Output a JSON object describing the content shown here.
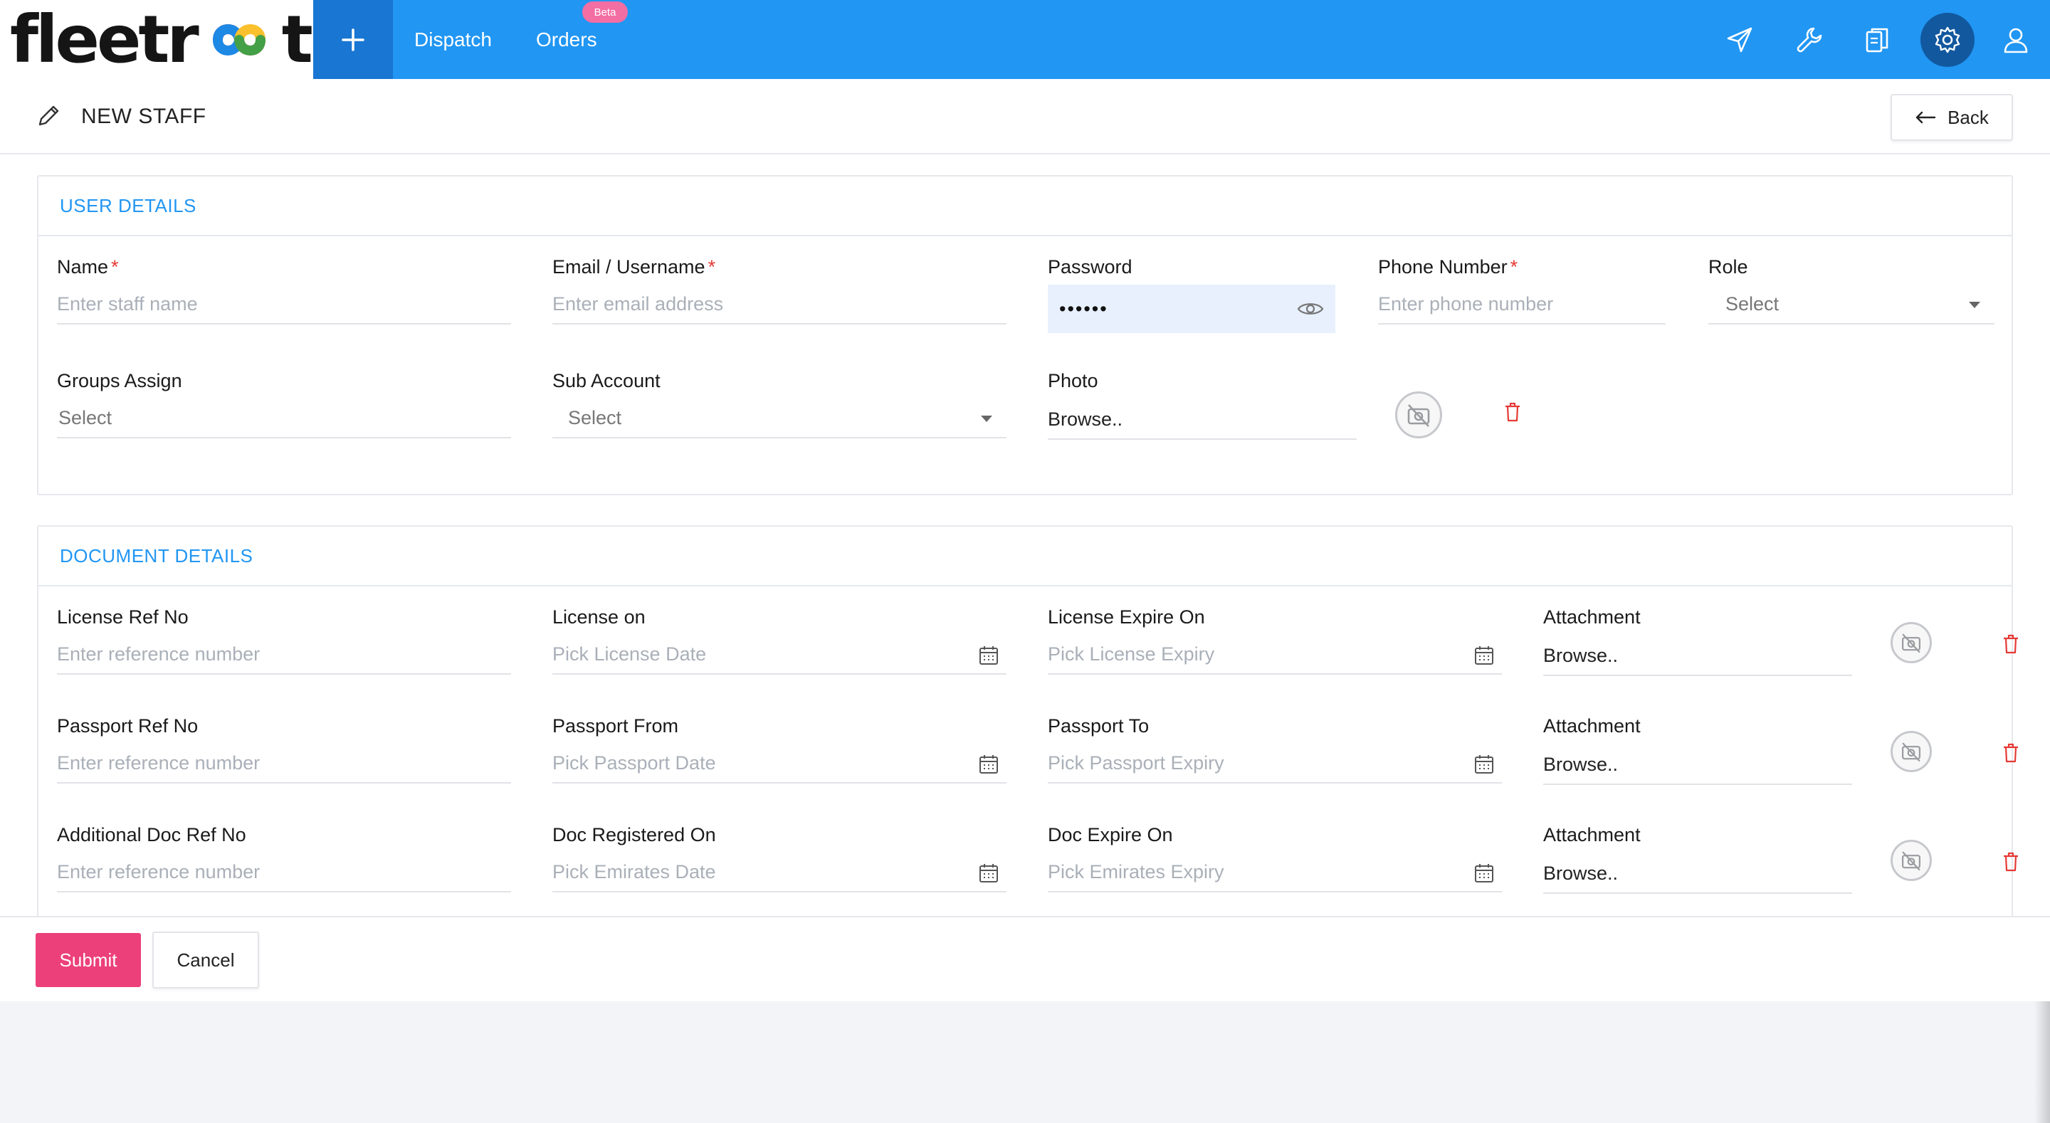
{
  "brand": {
    "logo_text_left": "fleetr",
    "logo_text_right": "t"
  },
  "nav": {
    "dispatch": "Dispatch",
    "orders": "Orders",
    "orders_badge": "Beta",
    "accent_color": "#2196f3",
    "icons": [
      "plus-icon",
      "send-icon",
      "wrench-icon",
      "documents-icon",
      "gear-icon",
      "user-icon"
    ]
  },
  "page": {
    "title": "NEW STAFF",
    "back_label": "Back"
  },
  "user_details": {
    "heading": "USER DETAILS",
    "name": {
      "label": "Name",
      "placeholder": "Enter staff name",
      "required": "*"
    },
    "email": {
      "label": "Email / Username",
      "placeholder": "Enter email address",
      "required": "*"
    },
    "password": {
      "label": "Password",
      "value": "••••••"
    },
    "phone": {
      "label": "Phone Number",
      "placeholder": "Enter phone number",
      "required": "*"
    },
    "role": {
      "label": "Role",
      "value": "Select"
    },
    "groups": {
      "label": "Groups Assign",
      "value": "Select"
    },
    "sub_account": {
      "label": "Sub Account",
      "value": "Select"
    },
    "photo": {
      "label": "Photo",
      "value": "Browse.."
    }
  },
  "document_details": {
    "heading": "DOCUMENT DETAILS",
    "rows": [
      {
        "ref_label": "License Ref No",
        "ref_placeholder": "Enter reference number",
        "from_label": "License on",
        "from_placeholder": "Pick License Date",
        "to_label": "License Expire On",
        "to_placeholder": "Pick License Expiry",
        "attach_label": "Attachment",
        "attach_value": "Browse.."
      },
      {
        "ref_label": "Passport Ref No",
        "ref_placeholder": "Enter reference number",
        "from_label": "Passport From",
        "from_placeholder": "Pick Passport Date",
        "to_label": "Passport To",
        "to_placeholder": "Pick Passport Expiry",
        "attach_label": "Attachment",
        "attach_value": "Browse.."
      },
      {
        "ref_label": "Additional Doc Ref No",
        "ref_placeholder": "Enter reference number",
        "from_label": "Doc Registered On",
        "from_placeholder": "Pick Emirates Date",
        "to_label": "Doc Expire On",
        "to_placeholder": "Pick Emirates Expiry",
        "attach_label": "Attachment",
        "attach_value": "Browse.."
      }
    ]
  },
  "footer": {
    "submit_label": "Submit",
    "cancel_label": "Cancel",
    "submit_color": "#ec407a"
  }
}
